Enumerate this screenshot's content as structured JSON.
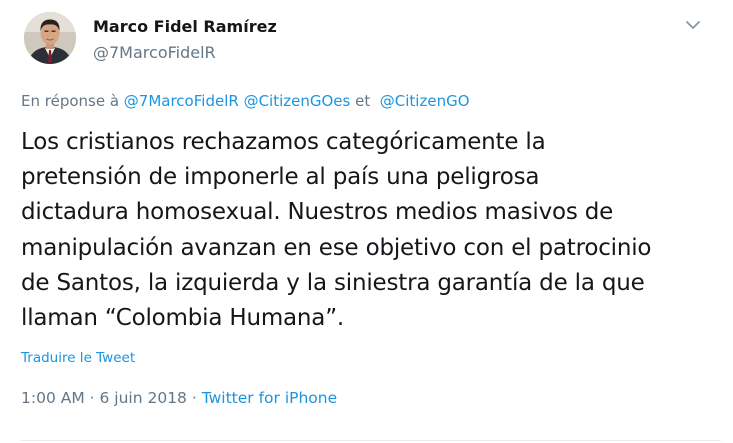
{
  "author": {
    "display_name": "Marco Fidel Ramírez",
    "handle": "@7MarcoFidelR"
  },
  "icons": {
    "menu": "chevron-down-icon",
    "avatar": "profile-photo"
  },
  "reply": {
    "prefix": "En réponse à ",
    "mention_1": "@7MarcoFidelR",
    "mention_2": "@CitizenGOes",
    "separator": " et ",
    "mention_3": "@CitizenGO"
  },
  "tweet": {
    "text": "Los cristianos rechazamos categóricamente la\npretensión de imponerle al país una peligrosa\ndictadura homosexual. Nuestros medios masivos de\nmanipulación avanzan en ese objetivo con el patrocinio\nde Santos, la izquierda y la siniestra garantía de la que\nllaman “Colombia Humana”.",
    "translate_label": "Traduire le Tweet"
  },
  "meta": {
    "time": "1:00 AM",
    "date_separator": " · ",
    "date": "6 juin 2018",
    "source_separator": " · ",
    "source": "Twitter for iPhone"
  },
  "colors": {
    "text": "#14171a",
    "secondary": "#657786",
    "link": "#1b95e0"
  }
}
